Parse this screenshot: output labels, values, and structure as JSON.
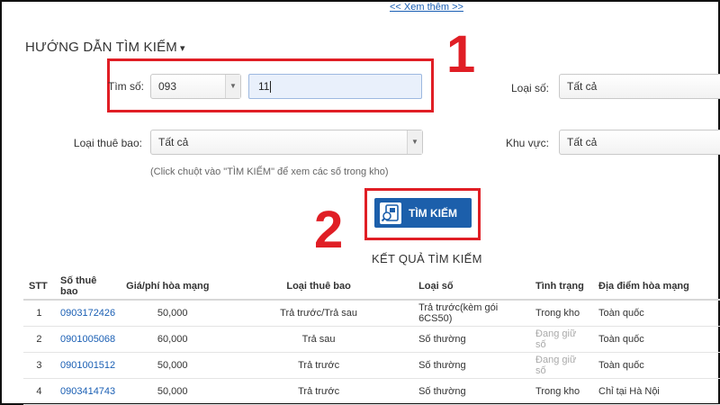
{
  "top_link": "<< Xem thêm >>",
  "guide": {
    "title": "HƯỚNG DẪN TÌM KIẾM",
    "caret": "▾"
  },
  "annotations": {
    "step1": "1",
    "step2": "2",
    "color": "#e01e25"
  },
  "form": {
    "find_number_label": "Tìm số:",
    "prefix_value": "093",
    "number_value": "11",
    "number_type_label": "Loại số:",
    "number_type_value": "Tất cả",
    "subscriber_type_label": "Loại thuê bao:",
    "subscriber_type_value": "Tất cả",
    "region_label": "Khu vực:",
    "region_value": "Tất cả",
    "hint": "(Click chuột vào \"TÌM KIẾM\" để xem các số trong kho)",
    "search_button": "TÌM KIẾM",
    "accent": "#1c5fab"
  },
  "results": {
    "title": "KẾT QUẢ TÌM KIẾM",
    "columns": [
      "STT",
      "Số thuê bao",
      "Giá/phí hòa mạng",
      "Loại thuê bao",
      "Loại số",
      "Tình trạng",
      "Địa điểm hòa mạng"
    ],
    "rows": [
      [
        "1",
        "0903172426",
        "50,000",
        "Trả trước/Trả sau",
        "Trả trước(kèm gói 6CS50)",
        "Trong kho",
        "Toàn quốc"
      ],
      [
        "2",
        "0901005068",
        "60,000",
        "Trả sau",
        "Số thường",
        "Đang giữ số",
        "Toàn quốc"
      ],
      [
        "3",
        "0901001512",
        "50,000",
        "Trả trước",
        "Số thường",
        "Đang giữ số",
        "Toàn quốc"
      ],
      [
        "4",
        "0903414743",
        "50,000",
        "Trả trước",
        "Số thường",
        "Trong kho",
        "Chỉ tại Hà Nội"
      ]
    ]
  }
}
